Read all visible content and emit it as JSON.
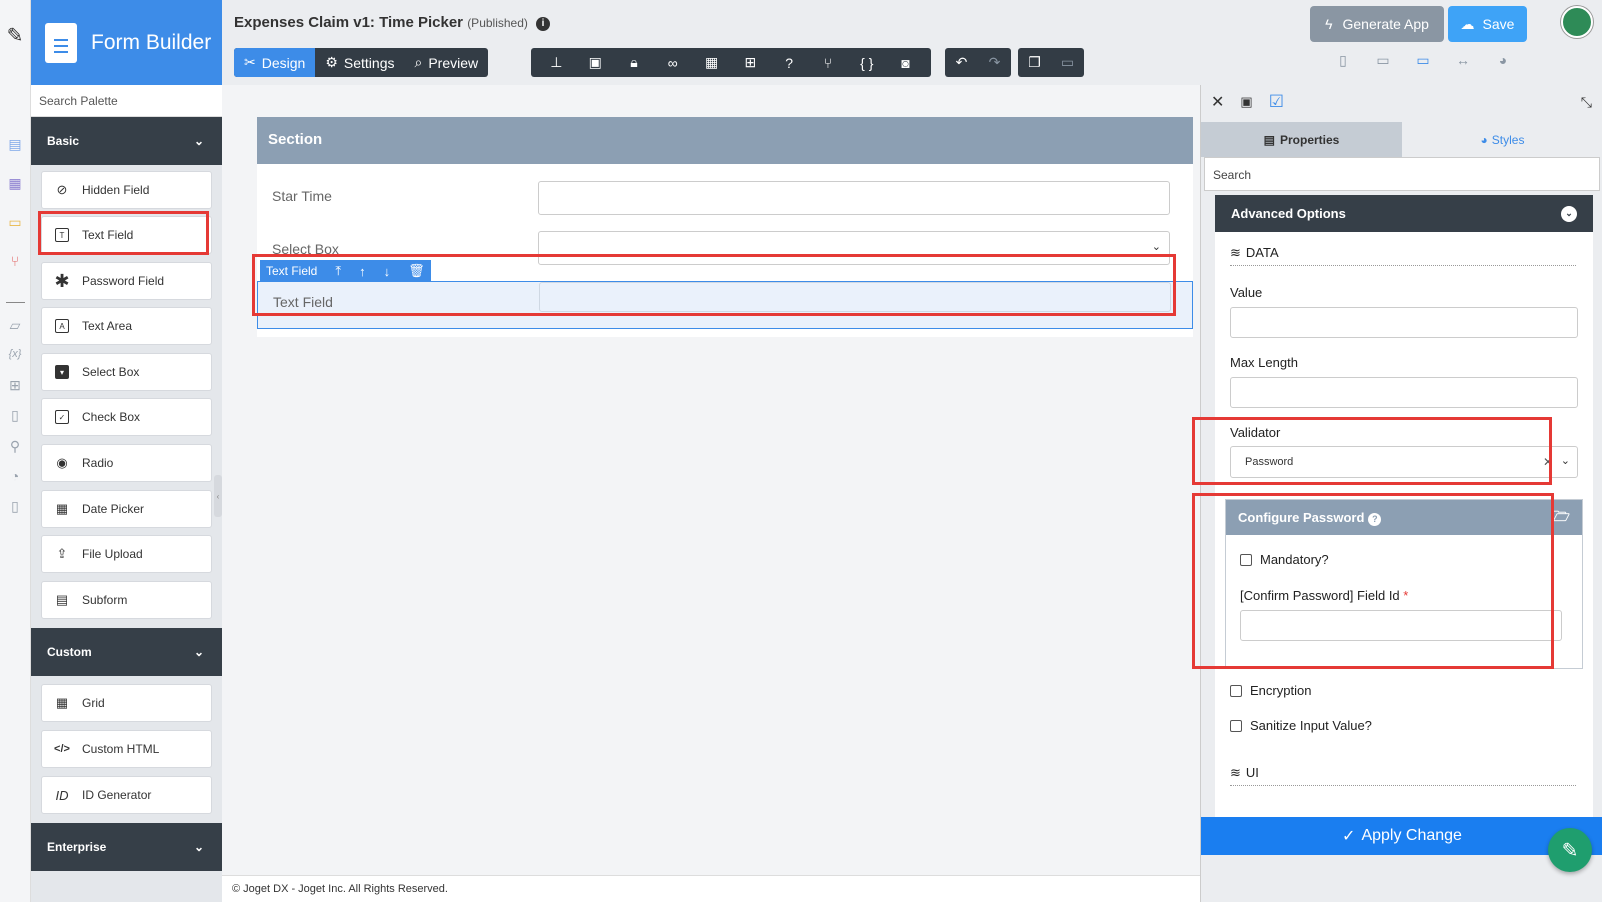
{
  "app": {
    "name": "Form Builder"
  },
  "rail": {
    "icons": [
      "edit-icon",
      "file-icon",
      "table-icon",
      "monitor-icon",
      "flow-icon",
      "note-icon",
      "variable-icon",
      "translate-icon",
      "report-icon",
      "plugin-icon",
      "dashboard-icon",
      "book-icon"
    ]
  },
  "palette": {
    "search_placeholder": "Search Palette",
    "categories": [
      {
        "label": "Basic",
        "items": [
          "Hidden Field",
          "Text Field",
          "Password Field",
          "Text Area",
          "Select Box",
          "Check Box",
          "Radio",
          "Date Picker",
          "File Upload",
          "Subform"
        ]
      },
      {
        "label": "Custom",
        "items": [
          "Grid",
          "Custom HTML",
          "ID Generator"
        ]
      },
      {
        "label": "Enterprise",
        "items": []
      }
    ]
  },
  "header": {
    "title": "Expenses Claim v1: Time Picker",
    "status": "(Published)",
    "tabs": [
      "Design",
      "Settings",
      "Preview"
    ],
    "generate_app": "Generate App",
    "save": "Save"
  },
  "canvas": {
    "section_title": "Section",
    "fields": [
      {
        "label": "Star Time"
      },
      {
        "label": "Select Box"
      },
      {
        "label": "Text Field"
      }
    ],
    "selected_toolbar_label": "Text Field"
  },
  "footer": "© Joget DX - Joget Inc. All Rights Reserved.",
  "properties": {
    "tabs": [
      "Properties",
      "Styles"
    ],
    "search_placeholder": "Search",
    "advanced_title": "Advanced Options",
    "data_group": "DATA",
    "value_label": "Value",
    "maxlength_label": "Max Length",
    "validator_label": "Validator",
    "validator_value": "Password",
    "configure_title": "Configure Password",
    "mandatory_label": "Mandatory?",
    "confirm_label": "[Confirm Password] Field Id",
    "required_mark": "*",
    "encryption_label": "Encryption",
    "sanitize_label": "Sanitize Input Value?",
    "ui_group": "UI",
    "apply": "Apply Change"
  },
  "colors": {
    "primary": "#3d8ce8",
    "dark": "#363f48",
    "highlight": "#e53935",
    "section": "#8c9fb3",
    "fab": "#1f9e6e"
  }
}
